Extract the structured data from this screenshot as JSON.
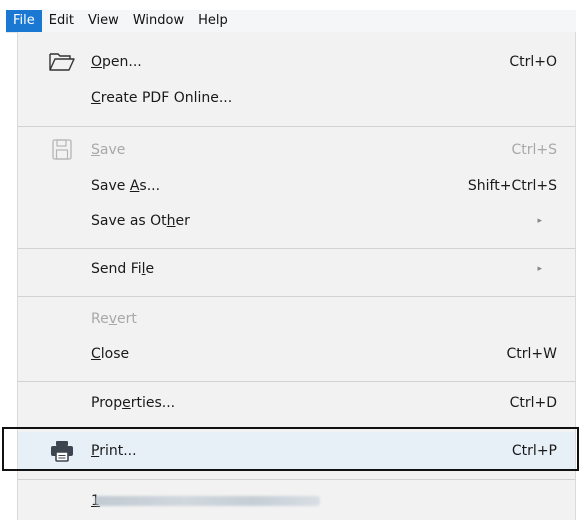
{
  "menubar": {
    "items": [
      {
        "label": "File",
        "active": true
      },
      {
        "label": "Edit"
      },
      {
        "label": "View"
      },
      {
        "label": "Window"
      },
      {
        "label": "Help"
      }
    ]
  },
  "file_menu": {
    "open": {
      "pre": "",
      "u": "O",
      "post": "pen...",
      "shortcut": "Ctrl+O"
    },
    "create_pdf": {
      "pre": "",
      "u": "C",
      "post": "reate PDF Online..."
    },
    "save": {
      "pre": "",
      "u": "S",
      "post": "ave",
      "shortcut": "Ctrl+S",
      "disabled": true
    },
    "save_as": {
      "pre": "Save ",
      "u": "A",
      "post": "s...",
      "shortcut": "Shift+Ctrl+S"
    },
    "save_as_other": {
      "pre": "Save as Ot",
      "u": "h",
      "post": "er"
    },
    "send_file": {
      "pre": "Send Fi",
      "u": "l",
      "post": "e"
    },
    "revert": {
      "pre": "Re",
      "u": "v",
      "post": "ert",
      "disabled": true
    },
    "close": {
      "pre": "",
      "u": "C",
      "post": "lose",
      "shortcut": "Ctrl+W"
    },
    "properties": {
      "pre": "Prop",
      "u": "e",
      "post": "rties...",
      "shortcut": "Ctrl+D"
    },
    "print": {
      "pre": "",
      "u": "P",
      "post": "rint...",
      "shortcut": "Ctrl+P"
    },
    "recent_index": "1",
    "submenu_arrow": "▸"
  },
  "colors": {
    "accent": "#1a78d2",
    "menu_bg": "#f2f2f2",
    "hover_bg": "#e7eff7",
    "disabled_text": "#a8a8a8"
  },
  "icons": {
    "open": "folder-open-icon",
    "save": "floppy-disk-icon",
    "print": "printer-icon"
  }
}
